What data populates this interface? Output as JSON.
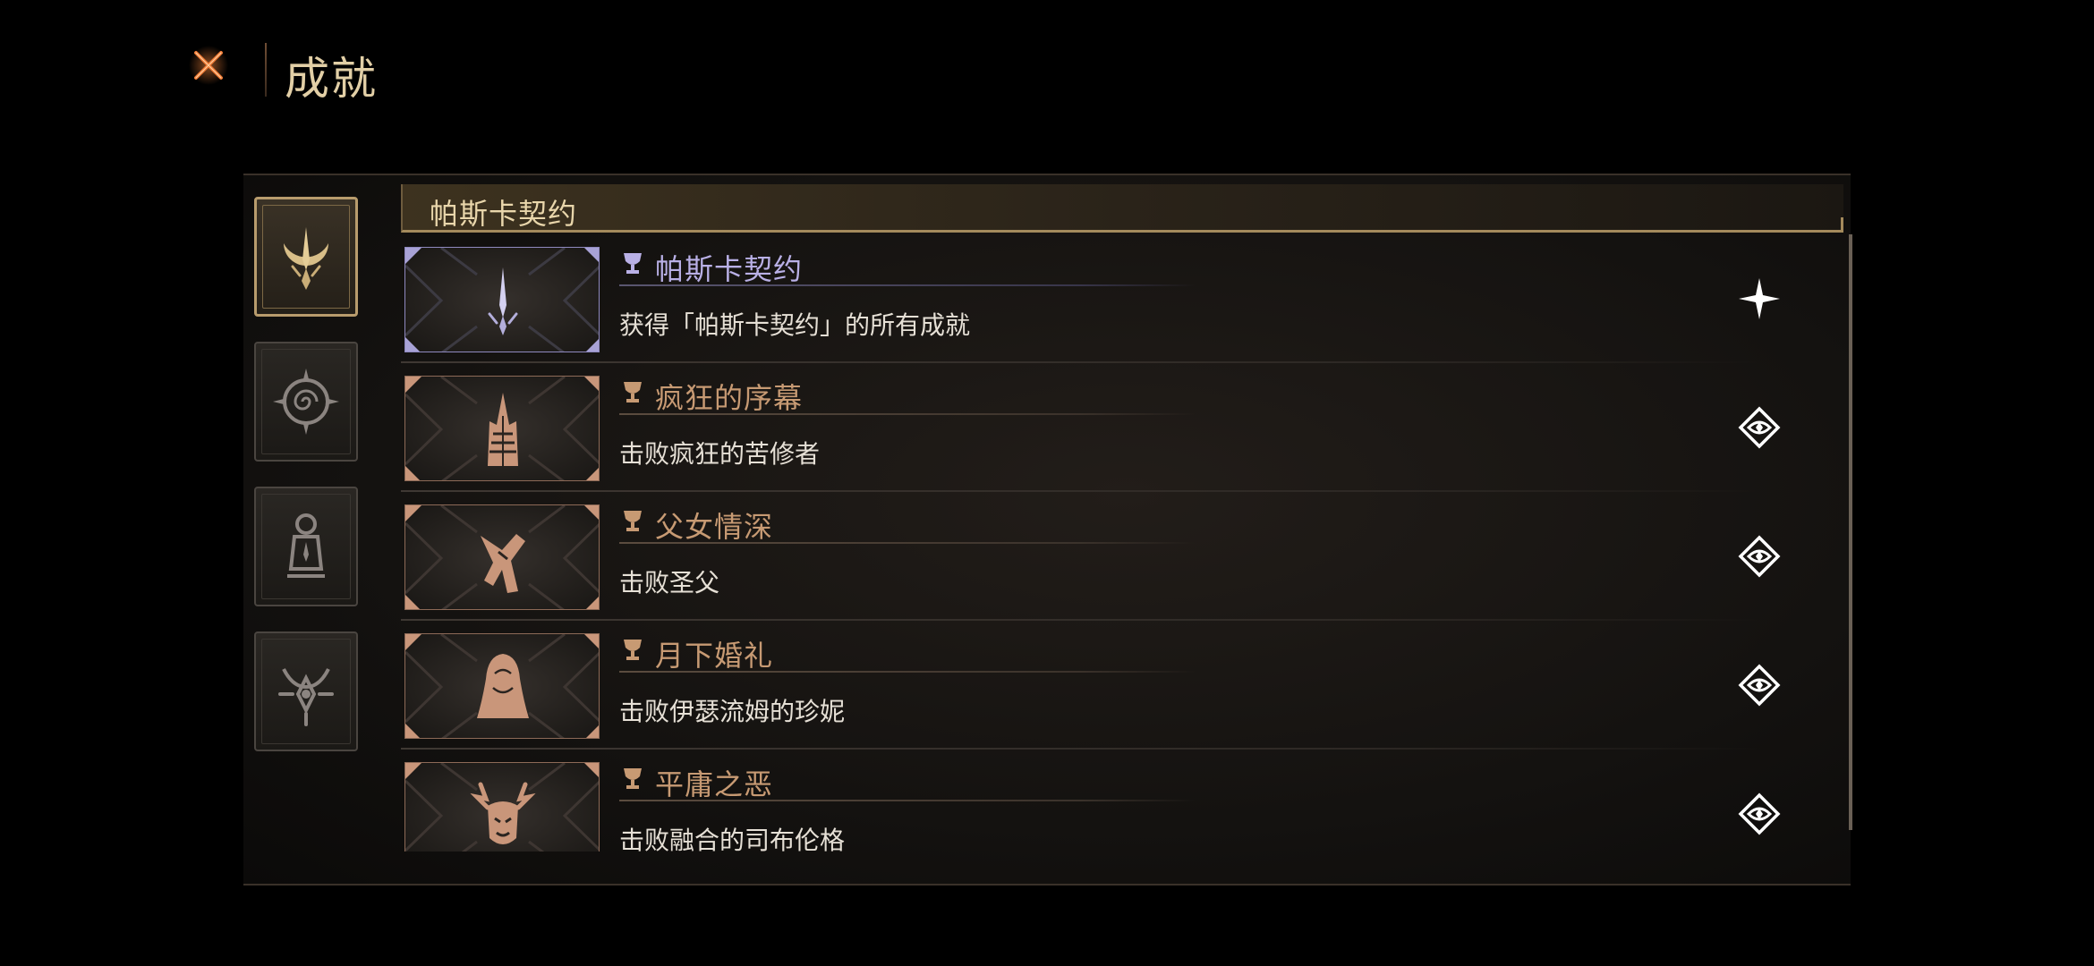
{
  "header": {
    "title": "成就",
    "close_icon": "close-x-icon",
    "accent_color": "#e26a2c"
  },
  "categories": [
    {
      "icon": "crescent-trident-icon",
      "active": true
    },
    {
      "icon": "spiral-compass-icon",
      "active": false
    },
    {
      "icon": "lantern-idol-icon",
      "active": false
    },
    {
      "icon": "horned-eye-icon",
      "active": false
    }
  ],
  "section": {
    "title": "帕斯卡契约"
  },
  "achievements": [
    {
      "title": "帕斯卡契约",
      "description": "获得「帕斯卡契约」的所有成就",
      "icon": "crescent-trident-icon",
      "trophy_icon": "trophy-icon",
      "status_icon": "star-sparkle-icon",
      "unlocked": true
    },
    {
      "title": "疯狂的序幕",
      "description": "击败疯狂的苦修者",
      "icon": "spired-tower-icon",
      "trophy_icon": "trophy-icon",
      "status_icon": "locked-sigil-icon",
      "unlocked": false
    },
    {
      "title": "父女情深",
      "description": "击败圣父",
      "icon": "bird-hand-icon",
      "trophy_icon": "trophy-icon",
      "status_icon": "locked-sigil-icon",
      "unlocked": false
    },
    {
      "title": "月下婚礼",
      "description": "击败伊瑟流姆的珍妮",
      "icon": "veiled-bride-icon",
      "trophy_icon": "trophy-icon",
      "status_icon": "locked-sigil-icon",
      "unlocked": false
    },
    {
      "title": "平庸之恶",
      "description": "击败融合的司布伦格",
      "icon": "antlered-beast-icon",
      "trophy_icon": "trophy-icon",
      "status_icon": "locked-sigil-icon",
      "unlocked": false
    }
  ],
  "colors": {
    "unlocked_frame": "#a8a2d6",
    "locked_frame": "#c9967a",
    "gold_accent": "#b89c6d"
  }
}
